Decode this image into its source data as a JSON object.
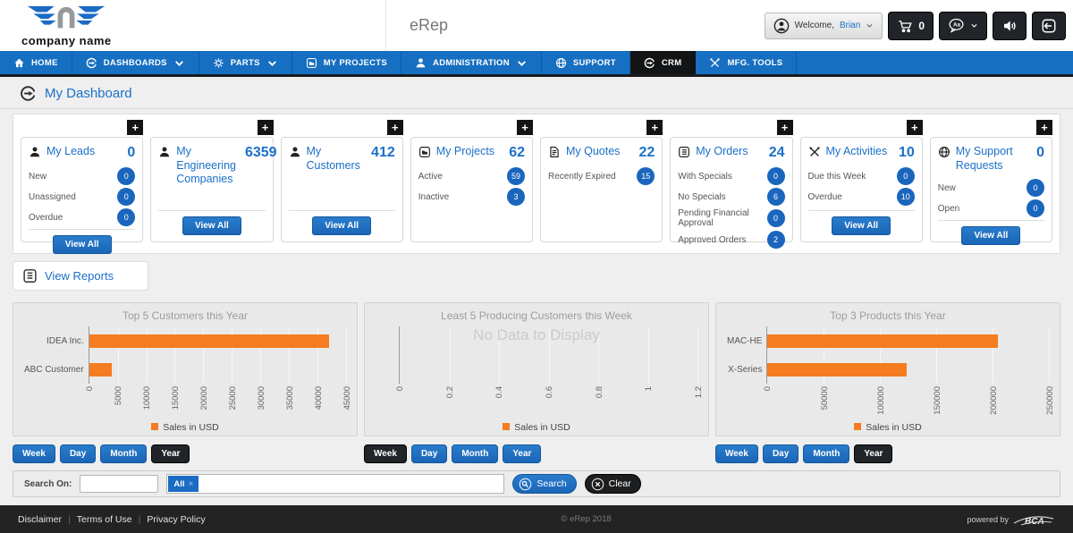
{
  "colors": {
    "primary_blue": "#176fc1",
    "accent_blue": "#1a70c8",
    "orange": "#f57c20",
    "dark": "#212529"
  },
  "header": {
    "logo_text": "company name",
    "app_name": "eRep",
    "welcome_label": "Welcome,",
    "welcome_user": "Brian",
    "cart_count": "0"
  },
  "nav": {
    "items": [
      {
        "label": "HOME",
        "icon": "home-icon",
        "caret": false,
        "active": false
      },
      {
        "label": "DASHBOARDS",
        "icon": "gauge-icon",
        "caret": true,
        "active": false
      },
      {
        "label": "PARTS",
        "icon": "gear-icon",
        "caret": true,
        "active": false
      },
      {
        "label": "MY PROJECTS",
        "icon": "projects-icon",
        "caret": false,
        "active": false
      },
      {
        "label": "ADMINISTRATION",
        "icon": "person-icon",
        "caret": true,
        "active": false
      },
      {
        "label": "SUPPORT",
        "icon": "globe-icon",
        "caret": false,
        "active": false
      },
      {
        "label": "CRM",
        "icon": "gauge-icon",
        "caret": false,
        "active": true
      },
      {
        "label": "MFG. TOOLS",
        "icon": "tools-icon",
        "caret": false,
        "active": false
      }
    ]
  },
  "page": {
    "title": "My Dashboard"
  },
  "cards_panel": {
    "add_widget_label": "+"
  },
  "cards": [
    {
      "title": "My Leads",
      "icon": "person-icon",
      "count": "0",
      "rows": [
        {
          "label": "New",
          "value": "0"
        },
        {
          "label": "Unassigned",
          "value": "0"
        },
        {
          "label": "Overdue",
          "value": "0"
        }
      ],
      "view_all": "View All"
    },
    {
      "title": "My Engineering Companies",
      "icon": "person-icon",
      "count": "6359",
      "rows": [],
      "view_all": "View All"
    },
    {
      "title": "My Customers",
      "icon": "person-icon",
      "count": "412",
      "rows": [],
      "view_all": "View All"
    },
    {
      "title": "My Projects",
      "icon": "projects-icon",
      "count": "62",
      "rows": [
        {
          "label": "Active",
          "value": "59"
        },
        {
          "label": "Inactive",
          "value": "3"
        }
      ],
      "view_all": null
    },
    {
      "title": "My Quotes",
      "icon": "document-icon",
      "count": "22",
      "rows": [
        {
          "label": "Recently Expired",
          "value": "15"
        }
      ],
      "view_all": null
    },
    {
      "title": "My Orders",
      "icon": "list-icon",
      "count": "24",
      "rows": [
        {
          "label": "With Specials",
          "value": "0"
        },
        {
          "label": "No Specials",
          "value": "6"
        },
        {
          "label": "Pending Financial Approval",
          "value": "0"
        },
        {
          "label": "Approved Orders",
          "value": "2"
        }
      ],
      "view_all": null
    },
    {
      "title": "My Activities",
      "icon": "tools-icon",
      "count": "10",
      "rows": [
        {
          "label": "Due this Week",
          "value": "0"
        },
        {
          "label": "Overdue",
          "value": "10"
        }
      ],
      "view_all": "View All"
    },
    {
      "title": "My Support Requests",
      "icon": "globe-icon",
      "count": "0",
      "rows": [
        {
          "label": "New",
          "value": "0"
        },
        {
          "label": "Open",
          "value": "0"
        }
      ],
      "view_all": "View All"
    }
  ],
  "view_reports_label": "View Reports",
  "chart_data": [
    {
      "type": "bar",
      "orientation": "horizontal",
      "title": "Top 5 Customers this Year",
      "categories": [
        "IDEA Inc.",
        "ABC Customer"
      ],
      "values": [
        42000,
        4000
      ],
      "xlim": [
        0,
        45000
      ],
      "xticks": [
        "0",
        "5000",
        "10000",
        "15000",
        "20000",
        "25000",
        "30000",
        "35000",
        "40000",
        "45000"
      ],
      "legend": "Sales in USD",
      "bar_color": "#f57c20",
      "grid": true,
      "periods": [
        "Week",
        "Day",
        "Month",
        "Year"
      ],
      "active_period": "Year"
    },
    {
      "type": "bar",
      "orientation": "horizontal",
      "title": "Least 5 Producing Customers this Week",
      "categories": [],
      "values": [],
      "xlim": [
        0,
        1.2
      ],
      "xticks": [
        "0",
        "0.2",
        "0.4",
        "0.6",
        "0.8",
        "1",
        "1.2"
      ],
      "no_data_text": "No Data to Display",
      "legend": "Sales in USD",
      "bar_color": "#f57c20",
      "grid": true,
      "periods": [
        "Week",
        "Day",
        "Month",
        "Year"
      ],
      "active_period": "Week"
    },
    {
      "type": "bar",
      "orientation": "horizontal",
      "title": "Top 3 Products this Year",
      "categories": [
        "MAC-HE",
        "X-Series"
      ],
      "values": [
        205000,
        124000
      ],
      "xlim": [
        0,
        250000
      ],
      "xticks": [
        "0",
        "50000",
        "100000",
        "150000",
        "200000",
        "250000"
      ],
      "legend": "Sales in USD",
      "bar_color": "#f57c20",
      "grid": true,
      "periods": [
        "Week",
        "Day",
        "Month",
        "Year"
      ],
      "active_period": "Year"
    }
  ],
  "search": {
    "label": "Search On:",
    "value": "",
    "tag": "All",
    "tag_remove": "×",
    "search_label": "Search",
    "clear_label": "Clear"
  },
  "footer": {
    "links": [
      "Disclaimer",
      "Terms of Use",
      "Privacy Policy"
    ],
    "copyright": "© eRep 2018",
    "powered_by": "powered by",
    "brand": "BCA"
  }
}
